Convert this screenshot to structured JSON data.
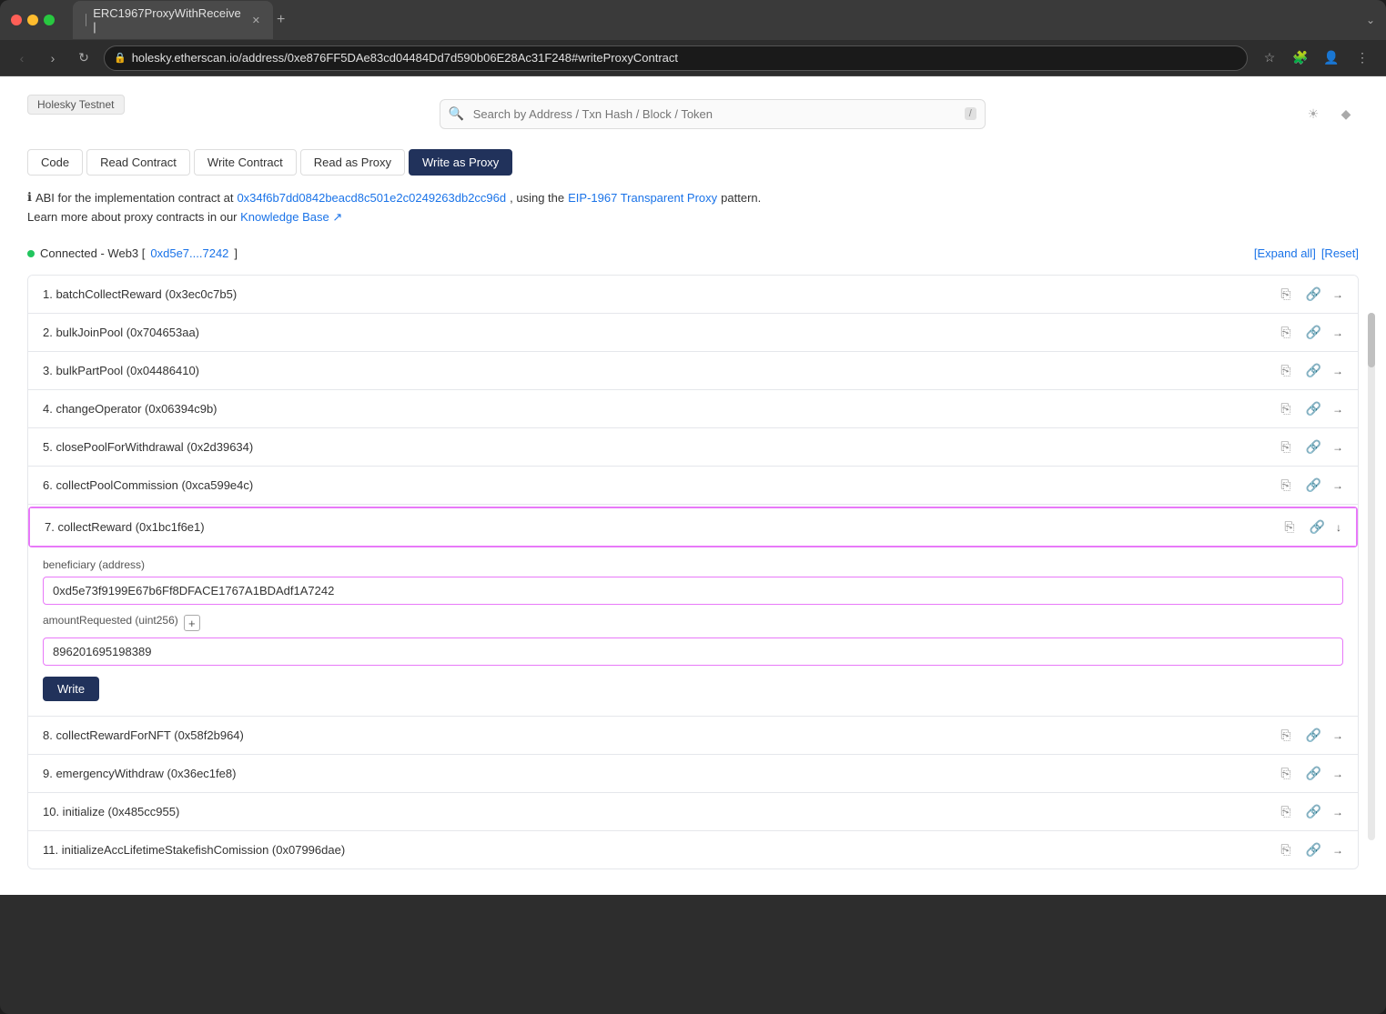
{
  "browser": {
    "tab_title": "ERC1967ProxyWithReceive |",
    "url": "holesky.etherscan.io/address/0xe876FF5DAe83cd04484Dd7d590b06E28Ac31F248#writeProxyContract",
    "new_tab_label": "+",
    "dropdown_label": "⌄"
  },
  "page": {
    "network_badge": "Holesky Testnet",
    "search_placeholder": "Search by Address / Txn Hash / Block / Token",
    "tabs": [
      {
        "label": "Code",
        "active": false
      },
      {
        "label": "Read Contract",
        "active": false
      },
      {
        "label": "Write Contract",
        "active": false
      },
      {
        "label": "Read as Proxy",
        "active": false
      },
      {
        "label": "Write as Proxy",
        "active": true
      }
    ],
    "abi_info_prefix": "ABI for the implementation contract at",
    "abi_address": "0x34f6b7dd0842beacd8c501e2c0249263db2cc96d",
    "abi_info_mid": ", using the",
    "abi_eip_label": "EIP-1967 Transparent Proxy",
    "abi_info_suffix": "pattern.",
    "learn_more_prefix": "Learn more about proxy contracts in our",
    "knowledge_base_label": "Knowledge Base",
    "connected_label": "Connected - Web3 [",
    "connected_address": "0xd5e7....7242",
    "connected_suffix": "]",
    "expand_all": "[Expand all]",
    "reset": "[Reset]",
    "contract_items": [
      {
        "id": 1,
        "title": "1. batchCollectReward (0x3ec0c7b5)",
        "expanded": false
      },
      {
        "id": 2,
        "title": "2. bulkJoinPool (0x704653aa)",
        "expanded": false
      },
      {
        "id": 3,
        "title": "3. bulkPartPool (0x04486410)",
        "expanded": false
      },
      {
        "id": 4,
        "title": "4. changeOperator (0x06394c9b)",
        "expanded": false
      },
      {
        "id": 5,
        "title": "5. closePoolForWithdrawal (0x2d39634)",
        "expanded": false
      },
      {
        "id": 6,
        "title": "6. collectPoolCommission (0xca599e4c)",
        "expanded": false
      },
      {
        "id": 7,
        "title": "7. collectReward (0x1bc1f6e1)",
        "expanded": true,
        "beneficiary_label": "beneficiary (address)",
        "beneficiary_value": "0xd5e73f9199E67b6Ff8DFACE1767A1BDAdf1A7242",
        "amount_label": "amountRequested (uint256)",
        "amount_value": "896201695198389",
        "write_btn": "Write"
      },
      {
        "id": 8,
        "title": "8. collectRewardForNFT (0x58f2b964)",
        "expanded": false
      },
      {
        "id": 9,
        "title": "9. emergencyWithdraw (0x36ec1fe8)",
        "expanded": false
      },
      {
        "id": 10,
        "title": "10. initialize (0x485cc955)",
        "expanded": false
      },
      {
        "id": 11,
        "title": "11. initializeAccLifetimeStakefishComission (0x07996dae)",
        "expanded": false
      }
    ]
  },
  "icons": {
    "search": "🔍",
    "copy": "⎘",
    "link": "🔗",
    "arrow_right": "→",
    "arrow_down": "↓",
    "info": "ℹ",
    "back": "←",
    "forward": "→",
    "refresh": "↻",
    "star": "☆",
    "extension": "🧩",
    "menu": "⋮",
    "sun": "☀",
    "eth": "◆"
  }
}
